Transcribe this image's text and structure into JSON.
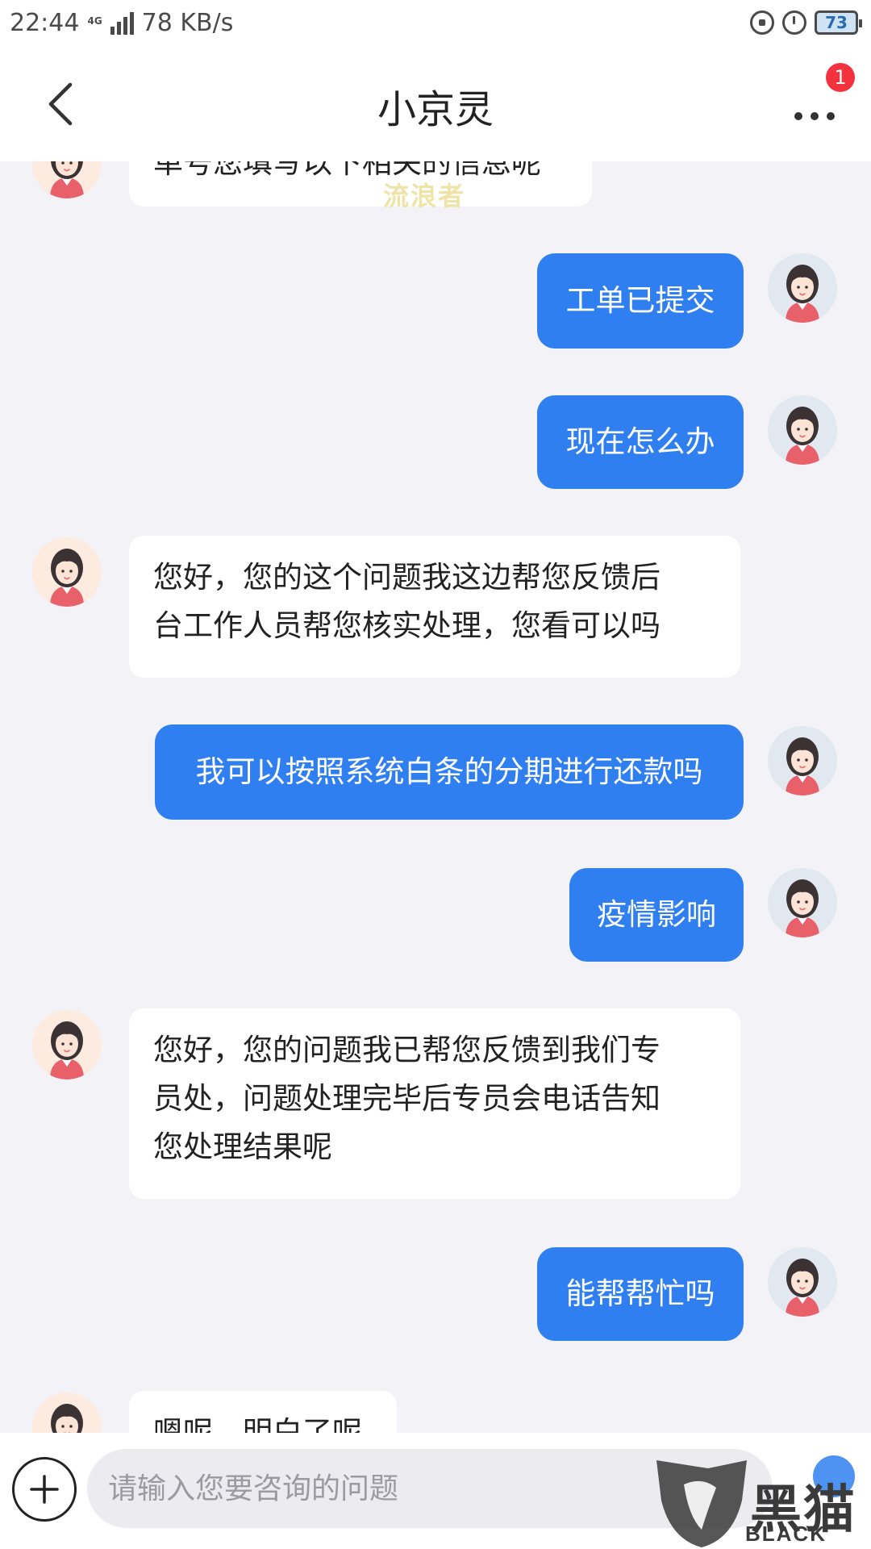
{
  "status_bar": {
    "time": "22:44",
    "network_type": "4G",
    "speed": "78 KB/s",
    "battery": "73",
    "icons": [
      "signal-icon",
      "rotation-lock-icon",
      "alarm-icon",
      "battery-icon"
    ]
  },
  "header": {
    "title": "小京灵",
    "badge_count": "1",
    "back_icon": "chevron-left-icon",
    "more_icon": "more-dots-icon"
  },
  "chat": {
    "partial_top_text": "单号您填写以下相关的信息呢",
    "watermark": "流浪者",
    "messages": [
      {
        "from": "user",
        "text": "工单已提交"
      },
      {
        "from": "user",
        "text": "现在怎么办"
      },
      {
        "from": "agent",
        "lines": [
          "您好，您的这个问题我这边帮您反馈后",
          "台工作人员帮您核实处理，您看可以吗"
        ]
      },
      {
        "from": "user",
        "text": "我可以按照系统白条的分期进行还款吗"
      },
      {
        "from": "user",
        "text": "疫情影响"
      },
      {
        "from": "agent",
        "lines": [
          "您好，您的问题我已帮您反馈到我们专",
          "员处，问题处理完毕后专员会电话告知",
          "您处理结果呢"
        ]
      },
      {
        "from": "user",
        "text": "能帮帮忙吗"
      },
      {
        "from": "agent",
        "lines": [
          "嗯呢，明白了呢"
        ]
      }
    ]
  },
  "input": {
    "placeholder": "请输入您要咨询的问题",
    "plus_icon": "plus-icon"
  },
  "overlay": {
    "brand_cn": "黑猫",
    "brand_en": "BLACK CAT"
  },
  "colors": {
    "user_bubble": "#2f7ff0",
    "agent_bubble": "#ffffff",
    "background": "#f2f2f7",
    "badge": "#f2323c"
  }
}
